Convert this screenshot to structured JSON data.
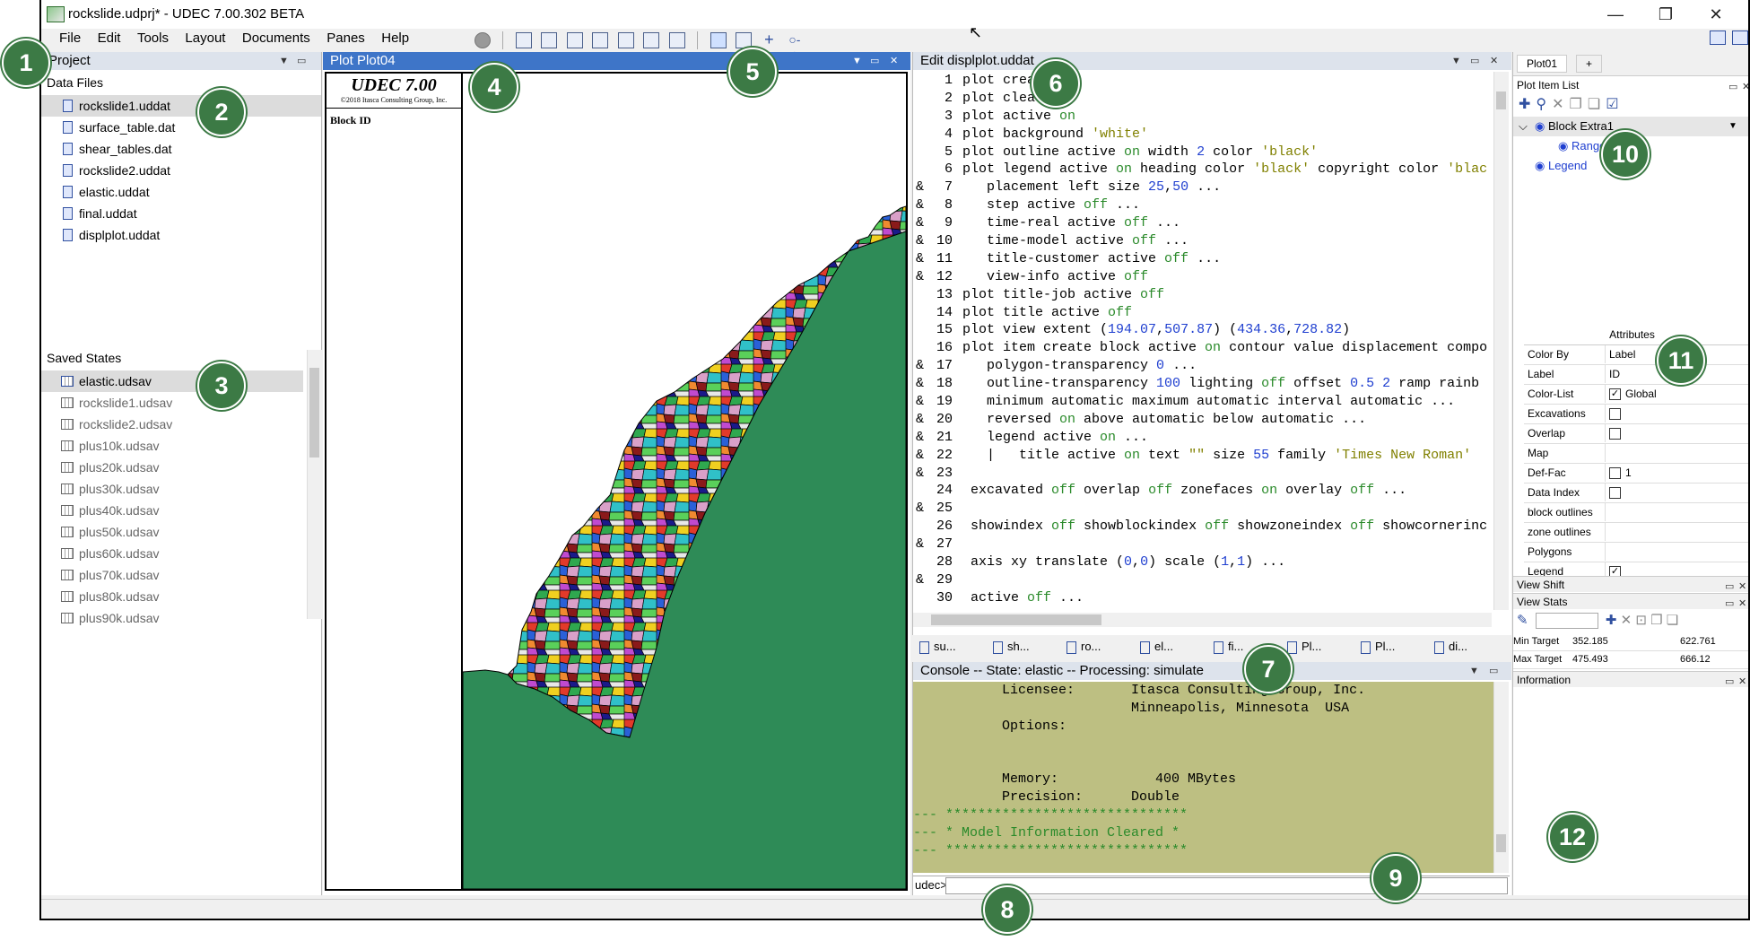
{
  "window": {
    "title": "rockslide.udprj* - UDEC 7.00.302 BETA",
    "minimize": "—",
    "restore": "❐",
    "close": "✕"
  },
  "menu": [
    "File",
    "Edit",
    "Tools",
    "Layout",
    "Documents",
    "Panes",
    "Help"
  ],
  "toolbar_icons": [
    "record-icon",
    "pane-left-icon",
    "pane-refresh-icon",
    "pane-save-icon",
    "pane-split-icon",
    "print-icon",
    "export-icon",
    "checkbox-icon",
    "pointer-icon",
    "measure-icon",
    "crosshair-icon",
    "line-icon"
  ],
  "project": {
    "header": "Project",
    "data_files_label": "Data Files",
    "data_files": [
      "rockslide1.uddat",
      "surface_table.dat",
      "shear_tables.dat",
      "rockslide2.uddat",
      "elastic.uddat",
      "final.uddat",
      "displplot.uddat"
    ],
    "saved_states_label": "Saved States",
    "saved_states": [
      "elastic.udsav",
      "rockslide1.udsav",
      "rockslide2.udsav",
      "plus10k.udsav",
      "plus20k.udsav",
      "plus30k.udsav",
      "plus40k.udsav",
      "plus50k.udsav",
      "plus60k.udsav",
      "plus70k.udsav",
      "plus80k.udsav",
      "plus90k.udsav"
    ]
  },
  "plot": {
    "header": "Plot Plot04",
    "legend_title": "UDEC 7.00",
    "legend_copyright": "©2018 Itasca Consulting Group, Inc.",
    "legend_item": "Block ID",
    "colors": {
      "ground": "#2e8b57",
      "outline": "#000000"
    }
  },
  "editor": {
    "header": "Edit displplot.uddat",
    "lines": [
      {
        "n": "1",
        "amp": "",
        "segs": [
          [
            "kw",
            "plot create"
          ]
        ]
      },
      {
        "n": "2",
        "amp": "",
        "segs": [
          [
            "kw",
            "plot clear"
          ]
        ]
      },
      {
        "n": "3",
        "amp": "",
        "segs": [
          [
            "kw",
            "plot active "
          ],
          [
            "kon",
            "on"
          ]
        ]
      },
      {
        "n": "4",
        "amp": "",
        "segs": [
          [
            "kw",
            "plot background "
          ],
          [
            "str",
            "'white'"
          ]
        ]
      },
      {
        "n": "5",
        "amp": "",
        "segs": [
          [
            "kw",
            "plot outline active "
          ],
          [
            "kon",
            "on"
          ],
          [
            "kw",
            " width "
          ],
          [
            "num",
            "2"
          ],
          [
            "kw",
            " color "
          ],
          [
            "str",
            "'black'"
          ]
        ]
      },
      {
        "n": "6",
        "amp": "",
        "segs": [
          [
            "kw",
            "plot legend active "
          ],
          [
            "kon",
            "on"
          ],
          [
            "kw",
            " heading color "
          ],
          [
            "str",
            "'black'"
          ],
          [
            "kw",
            " copyright color "
          ],
          [
            "str",
            "'blac"
          ]
        ]
      },
      {
        "n": "7",
        "amp": "&",
        "segs": [
          [
            "kw",
            "   placement left size "
          ],
          [
            "num",
            "25"
          ],
          [
            "kw",
            ","
          ],
          [
            "num",
            "50"
          ],
          [
            "kw",
            " ..."
          ]
        ]
      },
      {
        "n": "8",
        "amp": "&",
        "segs": [
          [
            "kw",
            "   step active "
          ],
          [
            "kon",
            "off"
          ],
          [
            "kw",
            " ..."
          ]
        ]
      },
      {
        "n": "9",
        "amp": "&",
        "segs": [
          [
            "kw",
            "   time-real active "
          ],
          [
            "kon",
            "off"
          ],
          [
            "kw",
            " ..."
          ]
        ]
      },
      {
        "n": "10",
        "amp": "&",
        "segs": [
          [
            "kw",
            "   time-model active "
          ],
          [
            "kon",
            "off"
          ],
          [
            "kw",
            " ..."
          ]
        ]
      },
      {
        "n": "11",
        "amp": "&",
        "segs": [
          [
            "kw",
            "   title-customer active "
          ],
          [
            "kon",
            "off"
          ],
          [
            "kw",
            " ..."
          ]
        ]
      },
      {
        "n": "12",
        "amp": "&",
        "segs": [
          [
            "kw",
            "   view-info active "
          ],
          [
            "kon",
            "off"
          ]
        ]
      },
      {
        "n": "13",
        "amp": "",
        "segs": [
          [
            "kw",
            "plot title-job active "
          ],
          [
            "kon",
            "off"
          ]
        ]
      },
      {
        "n": "14",
        "amp": "",
        "segs": [
          [
            "kw",
            "plot title active "
          ],
          [
            "kon",
            "off"
          ]
        ]
      },
      {
        "n": "15",
        "amp": "",
        "segs": [
          [
            "kw",
            "plot view extent ("
          ],
          [
            "num",
            "194.07"
          ],
          [
            "kw",
            ","
          ],
          [
            "num",
            "507.87"
          ],
          [
            "kw",
            ") ("
          ],
          [
            "num",
            "434.36"
          ],
          [
            "kw",
            ","
          ],
          [
            "num",
            "728.82"
          ],
          [
            "kw",
            ")"
          ]
        ]
      },
      {
        "n": "16",
        "amp": "",
        "segs": [
          [
            "kw",
            "plot item create block active "
          ],
          [
            "kon",
            "on"
          ],
          [
            "kw",
            " contour value displacement compo"
          ]
        ]
      },
      {
        "n": "17",
        "amp": "&",
        "segs": [
          [
            "kw",
            "   polygon-transparency "
          ],
          [
            "num",
            "0"
          ],
          [
            "kw",
            " ..."
          ]
        ]
      },
      {
        "n": "18",
        "amp": "&",
        "segs": [
          [
            "kw",
            "   outline-transparency "
          ],
          [
            "num",
            "100"
          ],
          [
            "kw",
            " lighting "
          ],
          [
            "kon",
            "off"
          ],
          [
            "kw",
            " offset "
          ],
          [
            "num",
            "0.5"
          ],
          [
            "kw",
            " "
          ],
          [
            "num",
            "2"
          ],
          [
            "kw",
            " ramp rainb"
          ]
        ]
      },
      {
        "n": "19",
        "amp": "&",
        "segs": [
          [
            "kw",
            "   minimum automatic maximum automatic interval automatic ..."
          ]
        ]
      },
      {
        "n": "20",
        "amp": "&",
        "segs": [
          [
            "kw",
            "   reversed "
          ],
          [
            "kon",
            "on"
          ],
          [
            "kw",
            " above automatic below automatic ..."
          ]
        ]
      },
      {
        "n": "21",
        "amp": "&",
        "segs": [
          [
            "kw",
            "   legend active "
          ],
          [
            "kon",
            "on"
          ],
          [
            "kw",
            " ..."
          ]
        ]
      },
      {
        "n": "22",
        "amp": "&",
        "segs": [
          [
            "kw",
            "   |   title active "
          ],
          [
            "kon",
            "on"
          ],
          [
            "kw",
            " text "
          ],
          [
            "str",
            "\"\""
          ],
          [
            "kw",
            " size "
          ],
          [
            "num",
            "55"
          ],
          [
            "kw",
            " family "
          ],
          [
            "str",
            "'Times New Roman'"
          ]
        ]
      },
      {
        "n": "23",
        "amp": "&",
        "segs": [
          [
            "kw",
            ""
          ]
        ]
      },
      {
        "n": "24",
        "amp": "",
        "segs": [
          [
            "kw",
            " excavated "
          ],
          [
            "kon",
            "off"
          ],
          [
            "kw",
            " overlap "
          ],
          [
            "kon",
            "off"
          ],
          [
            "kw",
            " zonefaces "
          ],
          [
            "kon",
            "on"
          ],
          [
            "kw",
            " overlay "
          ],
          [
            "kon",
            "off"
          ],
          [
            "kw",
            " ..."
          ]
        ]
      },
      {
        "n": "25",
        "amp": "&",
        "segs": [
          [
            "kw",
            ""
          ]
        ]
      },
      {
        "n": "26",
        "amp": "",
        "segs": [
          [
            "kw",
            " showindex "
          ],
          [
            "kon",
            "off"
          ],
          [
            "kw",
            " showblockindex "
          ],
          [
            "kon",
            "off"
          ],
          [
            "kw",
            " showzoneindex "
          ],
          [
            "kon",
            "off"
          ],
          [
            "kw",
            " showcornerinc"
          ]
        ]
      },
      {
        "n": "27",
        "amp": "&",
        "segs": [
          [
            "kw",
            ""
          ]
        ]
      },
      {
        "n": "28",
        "amp": "",
        "segs": [
          [
            "kw",
            " axis xy translate ("
          ],
          [
            "num",
            "0"
          ],
          [
            "kw",
            ","
          ],
          [
            "num",
            "0"
          ],
          [
            "kw",
            ") scale ("
          ],
          [
            "num",
            "1"
          ],
          [
            "kw",
            ","
          ],
          [
            "num",
            "1"
          ],
          [
            "kw",
            ") ..."
          ]
        ]
      },
      {
        "n": "29",
        "amp": "&",
        "segs": [
          [
            "kw",
            ""
          ]
        ]
      },
      {
        "n": "30",
        "amp": "",
        "segs": [
          [
            "kw",
            " active "
          ],
          [
            "kon",
            "off"
          ],
          [
            "kw",
            " ..."
          ]
        ]
      }
    ],
    "tabs": [
      "su...",
      "sh...",
      "ro...",
      "el...",
      "fi...",
      "Pl...",
      "Pl...",
      "di..."
    ]
  },
  "console": {
    "header": "Console -- State: elastic -- Processing: simulate",
    "lines": [
      {
        "t": "           Licensee:       Itasca Consulting Group, Inc.",
        "c": ""
      },
      {
        "t": "                           Minneapolis, Minnesota  USA",
        "c": ""
      },
      {
        "t": "           Options:",
        "c": ""
      },
      {
        "t": "",
        "c": ""
      },
      {
        "t": "",
        "c": ""
      },
      {
        "t": "           Memory:            400 MBytes",
        "c": ""
      },
      {
        "t": "           Precision:      Double",
        "c": ""
      },
      {
        "t": "--- ******************************",
        "c": "cgreen"
      },
      {
        "t": "--- * Model Information Cleared *",
        "c": "cgreen"
      },
      {
        "t": "--- ******************************",
        "c": "cgreen"
      }
    ],
    "prompt": "udec>"
  },
  "right": {
    "tab_active": "Plot01",
    "tab_add": "+",
    "plot_item_list": "Plot Item List",
    "tree": [
      {
        "label": "Block Extra1",
        "level": 0
      },
      {
        "label": "Range",
        "level": 1
      },
      {
        "label": "Legend",
        "level": 0
      }
    ],
    "attributes_title": "Attributes",
    "attributes": [
      {
        "name": "Color By",
        "value": "Label",
        "type": "select"
      },
      {
        "name": "Label",
        "value": "ID",
        "type": "text"
      },
      {
        "name": "Color-List",
        "value": "Global",
        "type": "check-on"
      },
      {
        "name": "Excavations",
        "value": "",
        "type": "check-off"
      },
      {
        "name": "Overlap",
        "value": "",
        "type": "check-off"
      },
      {
        "name": "Map",
        "value": "",
        "type": "text"
      },
      {
        "name": "Def-Fac",
        "value": "1",
        "type": "check-off"
      },
      {
        "name": "Data Index",
        "value": "",
        "type": "check-off"
      },
      {
        "name": "block outlines",
        "value": "",
        "type": "text"
      },
      {
        "name": "zone outlines",
        "value": "",
        "type": "text"
      },
      {
        "name": "Polygons",
        "value": "",
        "type": "text"
      },
      {
        "name": "Legend",
        "value": "",
        "type": "check-on"
      }
    ],
    "view_shift": "View Shift",
    "view_stats": "View Stats",
    "min_target_label": "Min Target",
    "min_target_a": "352.185",
    "min_target_b": "622.761",
    "max_target_label": "Max Target",
    "max_target_a": "475.493",
    "max_target_b": "666.12",
    "information": "Information"
  },
  "callouts": [
    "1",
    "2",
    "3",
    "4",
    "5",
    "6",
    "7",
    "8",
    "9",
    "10",
    "11",
    "12"
  ]
}
